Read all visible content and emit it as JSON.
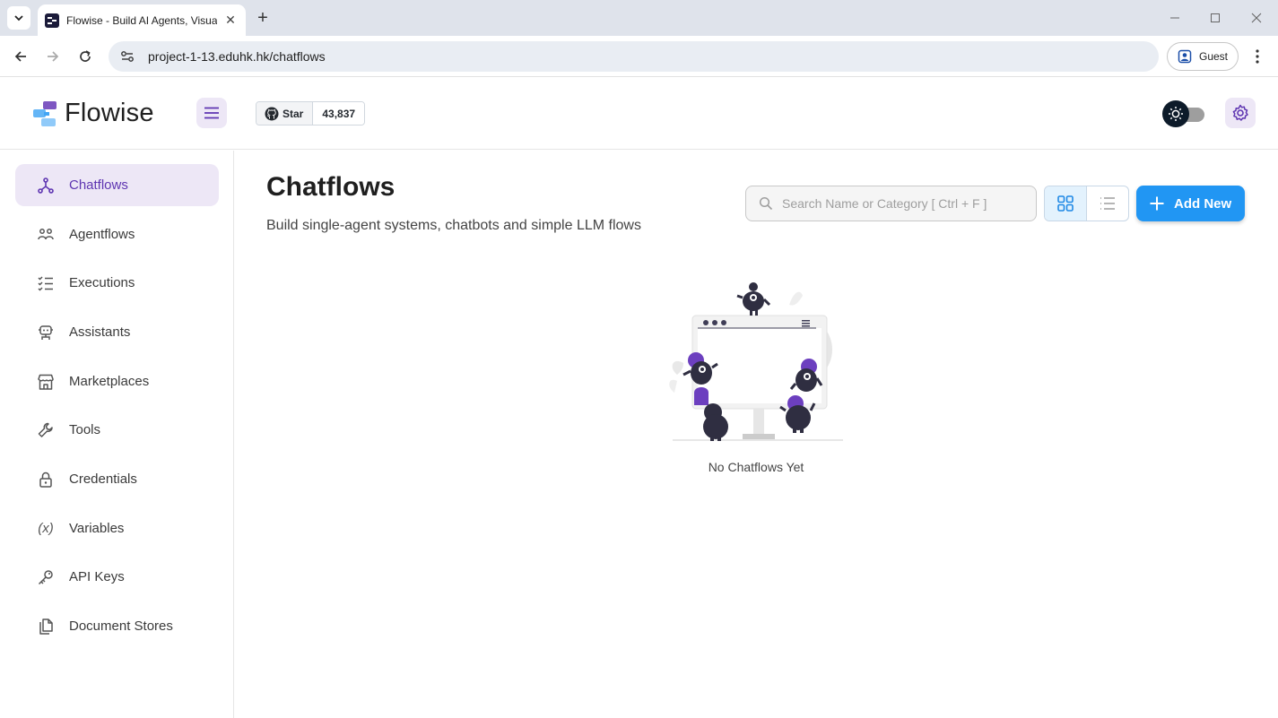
{
  "browser": {
    "tab_title": "Flowise - Build AI Agents, Visual",
    "url": "project-1-13.eduhk.hk/chatflows",
    "profile_label": "Guest"
  },
  "header": {
    "logo_text": "Flowise",
    "github_star_label": "Star",
    "github_star_count": "43,837"
  },
  "sidebar": {
    "items": [
      {
        "label": "Chatflows",
        "icon": "chatflows-icon",
        "active": true
      },
      {
        "label": "Agentflows",
        "icon": "agentflows-icon"
      },
      {
        "label": "Executions",
        "icon": "executions-icon"
      },
      {
        "label": "Assistants",
        "icon": "assistants-icon"
      },
      {
        "label": "Marketplaces",
        "icon": "marketplaces-icon"
      },
      {
        "label": "Tools",
        "icon": "tools-icon"
      },
      {
        "label": "Credentials",
        "icon": "credentials-icon"
      },
      {
        "label": "Variables",
        "icon": "variables-icon"
      },
      {
        "label": "API Keys",
        "icon": "api-keys-icon"
      },
      {
        "label": "Document Stores",
        "icon": "document-stores-icon"
      }
    ]
  },
  "main": {
    "title": "Chatflows",
    "subtitle": "Build single-agent systems, chatbots and simple LLM flows",
    "search_placeholder": "Search Name or Category [ Ctrl + F ]",
    "view_mode": "grid",
    "add_new_label": "Add New",
    "empty_text": "No Chatflows Yet"
  },
  "colors": {
    "accent_purple": "#5e35b1",
    "active_bg": "#ede7f6",
    "primary_blue": "#2196f3"
  }
}
